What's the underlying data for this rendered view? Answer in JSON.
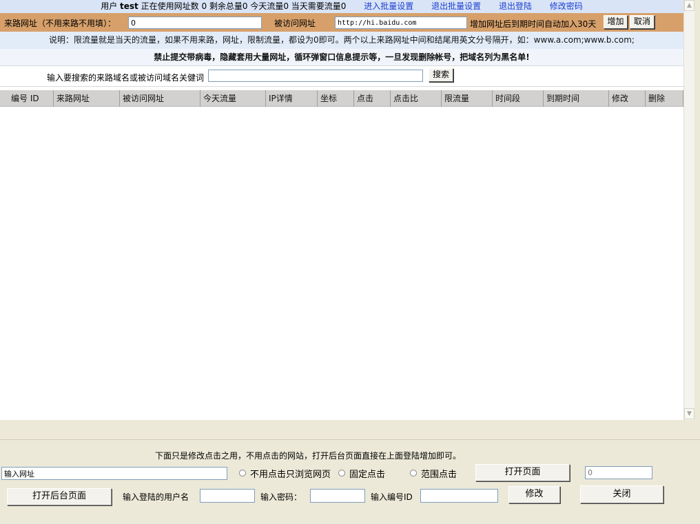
{
  "top_bar": {
    "user_prefix": "用户",
    "username": "test",
    "status_text": "正在使用网址数 0 剩余总量0 今天流量0 当天需要流量0",
    "links": [
      "进入批量设置",
      "退出批量设置",
      "退出登陆",
      "修改密码"
    ]
  },
  "add_form": {
    "referrer_label": "来路网址（不用来路不用填）：",
    "referrer_value": "0",
    "target_label": "被访问网址",
    "target_value": "http://hi.baidu.com",
    "note": "增加网址后到期时间自动加入30天",
    "add_button": "增加",
    "cancel_button": "取消"
  },
  "notice": {
    "description": "说明：限流量就是当天的流量，如果不用来路，网址，限制流量，都设为0即可。两个以上来路网址中间和结尾用英文分号隔开，如：www.a.com;www.b.com;",
    "warning": "禁止提交带病毒，隐藏套用大量网址，循环弹窗口信息提示等，一旦发现删除帐号，把域名列为黑名单!"
  },
  "search": {
    "label": "输入要搜索的来路域名或被访问域名关健词",
    "value": "",
    "button": "搜索"
  },
  "table": {
    "columns": [
      "编号 ID",
      "来路网址",
      "被访问网址",
      "今天流量",
      "IP详情",
      "坐标",
      "点击",
      "点击比",
      "限流量",
      "时间段",
      "到期时间",
      "修改",
      "删除"
    ],
    "rows": []
  },
  "bottom": {
    "instruction": "下面只是修改点击之用，不用点击的网站，打开后台页面直接在上面登陆增加即可。",
    "url_input_value": "输入网址",
    "radio_options": [
      "不用点击只浏览网页",
      "固定点击",
      "范围点击"
    ],
    "open_page_button": "打开页面",
    "number_placeholder": "0",
    "open_admin_button": "打开后台页面",
    "username_label": "输入登陆的用户名",
    "password_label": "输入密码：",
    "id_label": "输入编号ID",
    "modify_button": "修改",
    "close_button": "关闭"
  }
}
